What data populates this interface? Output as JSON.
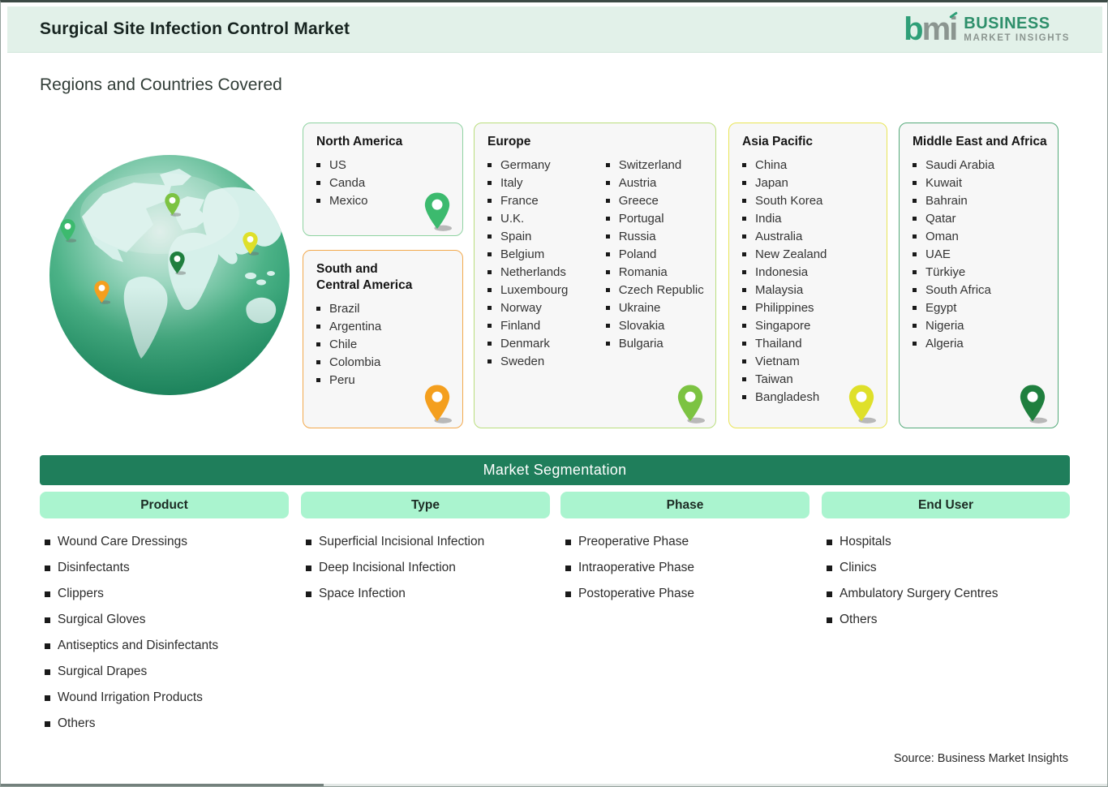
{
  "header": {
    "title": "Surgical Site Infection Control Market",
    "logo": {
      "mark_b": "b",
      "mark_m": "m",
      "mark_i": "i",
      "name_line1": "BUSINESS",
      "name_line2": "MARKET INSIGHTS"
    }
  },
  "section_title": "Regions and Countries Covered",
  "regions": [
    {
      "name": "North America",
      "countries": [
        "US",
        "Canda",
        "Mexico"
      ],
      "pin_color": "#3cba6e",
      "border_color": "#8fd3a2"
    },
    {
      "name": "South and Central America",
      "countries": [
        "Brazil",
        "Argentina",
        "Chile",
        "Colombia",
        "Peru"
      ],
      "pin_color": "#f49f1e",
      "border_color": "#f2a94d"
    },
    {
      "name": "Europe",
      "countries_col1": [
        "Germany",
        "Italy",
        "France",
        "U.K.",
        "Spain",
        "Belgium",
        "Netherlands",
        "Luxembourg",
        "Norway",
        "Finland",
        "Denmark",
        "Sweden"
      ],
      "countries_col2": [
        "Switzerland",
        "Austria",
        "Greece",
        "Portugal",
        "Russia",
        "Poland",
        "Romania",
        "Czech Republic",
        "Ukraine",
        "Slovakia",
        "Bulgaria"
      ],
      "pin_color": "#7cc342",
      "border_color": "#bade7e"
    },
    {
      "name": "Asia Pacific",
      "countries": [
        "China",
        "Japan",
        "South Korea",
        "India",
        "Australia",
        "New Zealand",
        "Indonesia",
        "Malaysia",
        "Philippines",
        "Singapore",
        "Thailand",
        "Vietnam",
        "Taiwan",
        "Bangladesh"
      ],
      "pin_color": "#dfe02a",
      "border_color": "#e9e556"
    },
    {
      "name": "Middle East and Africa",
      "countries": [
        "Saudi Arabia",
        "Kuwait",
        "Bahrain",
        "Qatar",
        "Oman",
        "UAE",
        "Türkiye",
        "South Africa",
        "Egypt",
        "Nigeria",
        "Algeria"
      ],
      "pin_color": "#1f7f3e",
      "border_color": "#55aa7a"
    }
  ],
  "segmentation": {
    "title": "Market Segmentation",
    "columns": [
      {
        "label": "Product",
        "items": [
          "Wound Care Dressings",
          "Disinfectants",
          "Clippers",
          "Surgical Gloves",
          "Antiseptics and Disinfectants",
          "Surgical Drapes",
          "Wound Irrigation Products",
          "Others"
        ]
      },
      {
        "label": "Type",
        "items": [
          "Superficial Incisional Infection",
          "Deep Incisional Infection",
          "Space Infection"
        ]
      },
      {
        "label": "Phase",
        "items": [
          "Preoperative Phase",
          "Intraoperative Phase",
          "Postoperative Phase"
        ]
      },
      {
        "label": "End User",
        "items": [
          "Hospitals",
          "Clinics",
          "Ambulatory Surgery Centres",
          "Others"
        ]
      }
    ]
  },
  "source": "Source: Business Market Insights",
  "colors": {
    "header_bg": "#e2f1e9",
    "banner_green": "#1f7e5b",
    "pill_mint": "#aaf4cf",
    "card_bg": "#f7f7f7",
    "logo_green": "#2f9f78",
    "logo_gray": "#8b9590",
    "globe_dark_green": "#1f8a60",
    "globe_land": "#d6f0ea"
  }
}
